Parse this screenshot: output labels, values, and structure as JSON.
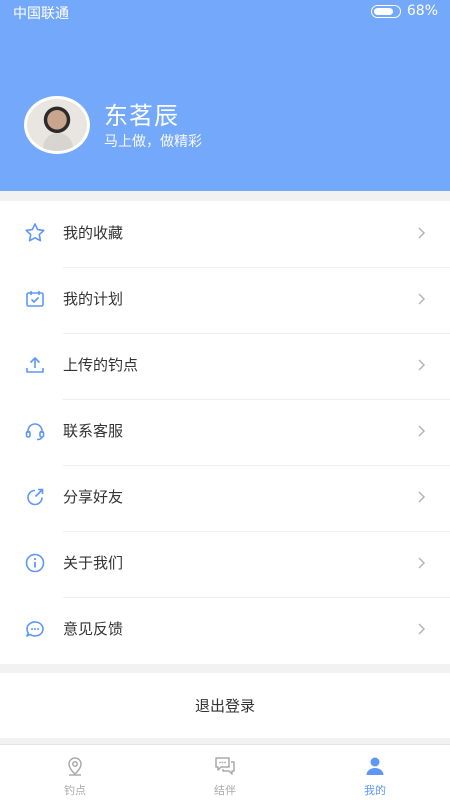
{
  "status_bar": {
    "carrier": "中国联通",
    "battery_percent": "68%",
    "battery_level": 0.68
  },
  "profile": {
    "name": "东茗辰",
    "motto": "马上做，做精彩"
  },
  "menu": [
    {
      "label": "我的收藏",
      "icon": "star-icon"
    },
    {
      "label": "我的计划",
      "icon": "calendar-check-icon"
    },
    {
      "label": "上传的钓点",
      "icon": "upload-icon"
    },
    {
      "label": "联系客服",
      "icon": "headset-icon"
    },
    {
      "label": "分享好友",
      "icon": "share-icon"
    },
    {
      "label": "关于我们",
      "icon": "info-icon"
    },
    {
      "label": "意见反馈",
      "icon": "feedback-icon"
    }
  ],
  "logout_label": "退出登录",
  "tabs": [
    {
      "label": "钓点",
      "icon": "location-pin-icon",
      "active": false
    },
    {
      "label": "结伴",
      "icon": "chat-bubbles-icon",
      "active": false
    },
    {
      "label": "我的",
      "icon": "person-icon",
      "active": true
    }
  ],
  "colors": {
    "primary": "#74a8fb",
    "icon_blue": "#5f97f6",
    "text": "#333333",
    "inactive": "#aaaaaa"
  }
}
